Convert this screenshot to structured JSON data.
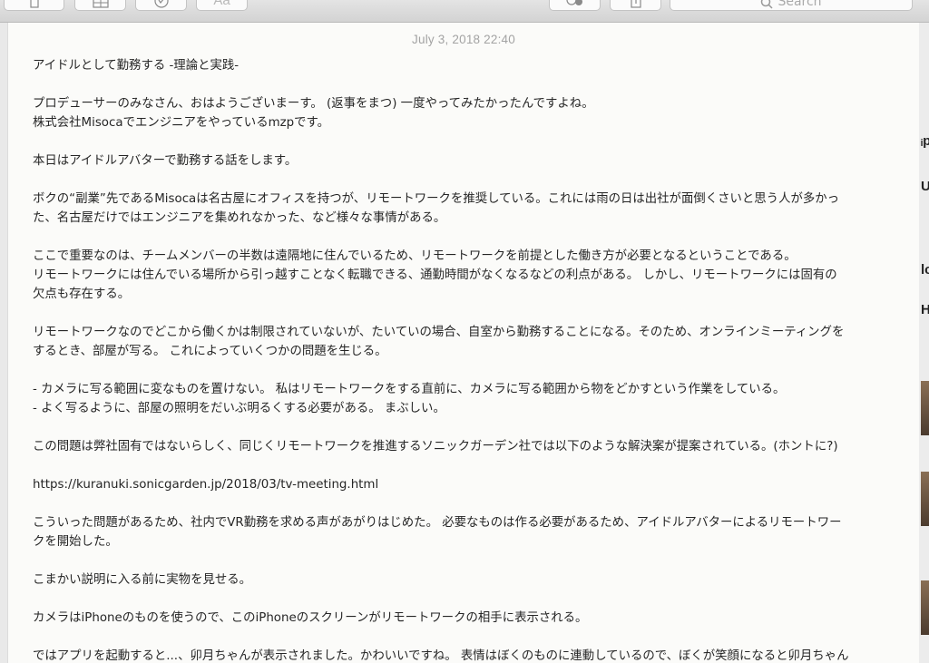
{
  "toolbar": {
    "font_button_label": "Aa",
    "search_placeholder": "Search"
  },
  "note": {
    "date": "July 3, 2018 22:40",
    "lines": [
      "アイドルとして勤務する -理論と実践-",
      "",
      "プロデューサーのみなさん、おはようございまーす。 (返事をまつ) 一度やってみたかったんですよね。",
      "株式会社Misocaでエンジニアをやっているmzpです。",
      "",
      "本日はアイドルアバターで勤務する話をします。",
      "",
      "ボクの“副業”先であるMisocaは名古屋にオフィスを持つが、リモートワークを推奨している。これには雨の日は出社が面倒くさいと思う人が多かっ",
      "た、名古屋だけではエンジニアを集めれなかった、など様々な事情がある。",
      "",
      "ここで重要なのは、チームメンバーの半数は遠隔地に住んでいるため、リモートワークを前提とした働き方が必要となるということである。",
      "リモートワークには住んでいる場所から引っ越すことなく転職できる、通勤時間がなくなるなどの利点がある。 しかし、リモートワークには固有の",
      "欠点も存在する。",
      "",
      "リモートワークなのでどこから働くかは制限されていないが、たいていの場合、自室から勤務することになる。そのため、オンラインミーティングを",
      "するとき、部屋が写る。 これによっていくつかの問題を生じる。",
      "",
      " - カメラに写る範囲に変なものを置けない。 私はリモートワークをする直前に、カメラに写る範囲から物をどかすという作業をしている。",
      " - よく写るように、部屋の照明をだいぶ明るくする必要がある。 まぶしい。",
      "",
      "この問題は弊社固有ではないらしく、同じくリモートワークを推進するソニックガーデン社では以下のような解決案が提案されている。(ホントに?)",
      "",
      "https://kuranuki.sonicgarden.jp/2018/03/tv-meeting.html",
      "",
      "こういった問題があるため、社内でVR勤務を求める声があがりはじめた。 必要なものは作る必要があるため、アイドルアバターによるリモートワー",
      "クを開始した。",
      "",
      "こまかい説明に入る前に実物を見せる。",
      "",
      "カメラはiPhoneのものを使うので、このiPhoneのスクリーンがリモートワークの相手に表示される。",
      "",
      "ではアプリを起動すると...、卯月ちゃんが表示されました。かわいいですね。 表情はぼくのものに連動しているので、ぼくが笑顔になると卯月ちゃん"
    ]
  },
  "background_window": {
    "fragments": [
      "ᵢp",
      "U",
      "lc",
      "H"
    ]
  }
}
